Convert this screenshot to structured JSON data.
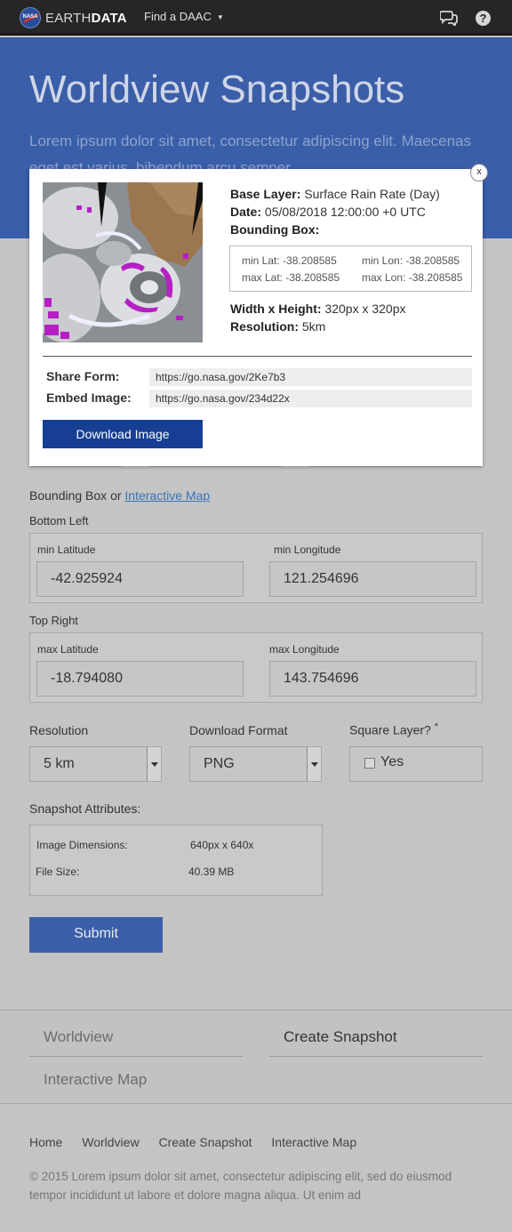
{
  "nav": {
    "brand_light": "EARTH",
    "brand_bold": "DATA",
    "logo_text": "NASA",
    "find_daac": "Find a DAAC",
    "help_glyph": "?"
  },
  "hero": {
    "title": "Worldview Snapshots",
    "subtitle": "Lorem ipsum dolor sit amet, consectetur adipiscing elit. Maecenas eget est varius, bibendum arcu semper"
  },
  "form": {
    "bbox_label": "Bounding Box or",
    "bbox_link": "Interactive Map",
    "bottom_left": "Bottom Left",
    "min_lat_label": "min Latitude",
    "min_lat_value": "-42.925924",
    "min_lon_label": "min Longitude",
    "min_lon_value": "121.254696",
    "top_right": "Top Right",
    "max_lat_label": "max Latitude",
    "max_lat_value": "-18.794080",
    "max_lon_label": "max Longitude",
    "max_lon_value": "143.754696",
    "resolution_label": "Resolution",
    "resolution_value": "5 km",
    "format_label": "Download Format",
    "format_value": "PNG",
    "square_label": "Square Layer?",
    "square_star": "*",
    "square_option": "Yes",
    "attributes_label": "Snapshot Attributes:",
    "dims_label": "Image Dimensions:",
    "dims_value": "640px x 640x",
    "size_label": "File Size:",
    "size_value": "40.39 MB",
    "submit": "Submit"
  },
  "footer_nav": {
    "worldview": "Worldview",
    "create_snapshot": "Create Snapshot",
    "interactive_map": "Interactive Map"
  },
  "footer_links": [
    "Home",
    "Worldview",
    "Create Snapshot",
    "Interactive Map"
  ],
  "copyright": "© 2015 Lorem ipsum dolor sit amet, consectetur adipiscing elit, sed do eiusmod tempor incididunt ut labore et dolore magna aliqua. Ut enim ad",
  "modal": {
    "close": "x",
    "base_layer_label": "Base Layer:",
    "base_layer_value": "Surface Rain Rate (Day)",
    "date_label": "Date:",
    "date_value": "05/08/2018 12:00:00 +0 UTC",
    "bbox_label": "Bounding Box:",
    "min_lat": "min Lat: -38.208585",
    "min_lon": "min Lon: -38.208585",
    "max_lat": "max Lat: -38.208585",
    "max_lon": "max Lon: -38.208585",
    "wh_label": "Width x Height:",
    "wh_value": "320px x 320px",
    "res_label": "Resolution:",
    "res_value": "5km",
    "share_label": "Share Form:",
    "share_value": "https://go.nasa.gov/2Ke7b3",
    "embed_label": "Embed Image:",
    "embed_value": "https://go.nasa.gov/234d22x",
    "download": "Download Image"
  },
  "icons": {
    "chat": "chat-bubbles-icon",
    "help": "help-icon",
    "caret": "caret-down-icon"
  }
}
